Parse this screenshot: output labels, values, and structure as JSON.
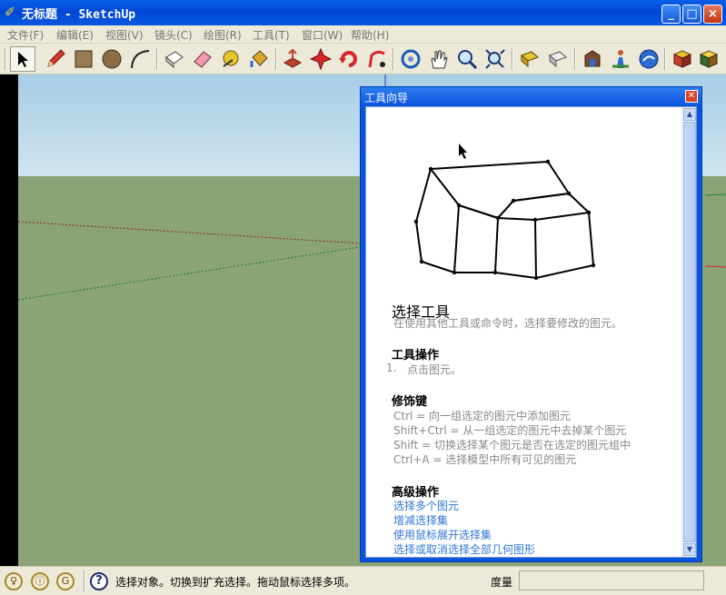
{
  "window": {
    "title": "无标题 - SketchUp",
    "minimize": "_",
    "maximize": "□",
    "close": "×"
  },
  "menu": [
    "文件(F)",
    "编辑(E)",
    "视图(V)",
    "镜头(C)",
    "绘图(R)",
    "工具(T)",
    "窗口(W)",
    "帮助(H)"
  ],
  "toolbar": {
    "selected_tool": "select-tool"
  },
  "instructor": {
    "title": "工具向导",
    "heading": "选择工具",
    "summary": "在使用其他工具或命令时，选择要修改的图元。",
    "ops_heading": "工具操作",
    "ops": [
      {
        "num": "1.",
        "text": "点击图元。"
      }
    ],
    "mod_heading": "修饰键",
    "modifiers": [
      "Ctrl = 向一组选定的图元中添加图元",
      "Shift+Ctrl = 从一组选定的图元中去掉某个图元",
      "Shift = 切换选择某个图元是否在选定的图元组中",
      "Ctrl+A = 选择模型中所有可见的图元"
    ],
    "adv_heading": "高级操作",
    "links": [
      "选择多个图元",
      "增减选择集",
      "使用鼠标展开选择集",
      "选择或取消选择全部几何图形"
    ]
  },
  "status": {
    "text": "选择对象。切换到扩充选择。拖动鼠标选择多项。",
    "measure_label": "度量",
    "measure_value": ""
  },
  "colors": {
    "sky": "#b9d8ec",
    "ground": "#8ba477",
    "xp_blue": "#0a55e0",
    "link": "#2f76d8"
  }
}
